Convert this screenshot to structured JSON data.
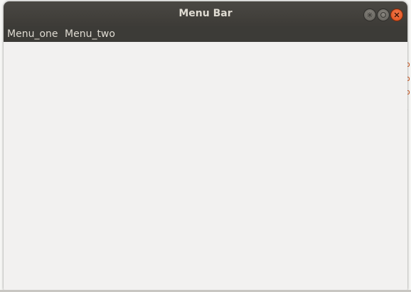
{
  "window": {
    "title": "Menu Bar",
    "controls": {
      "minimize_icon": "minimize-icon",
      "maximize_icon": "maximize-icon",
      "close_icon": "close-icon"
    }
  },
  "menubar": {
    "items": [
      {
        "label": "Menu_one"
      },
      {
        "label": "Menu_two"
      }
    ]
  },
  "background_glimpse": {
    "fragments": [
      "o",
      "o",
      "o",
      "i"
    ]
  },
  "colors": {
    "titlebar": "#3d3b37",
    "menubar": "#3c3b37",
    "menu_text": "#dfdbd2",
    "content": "#f2f1f0",
    "close_button": "#df4b16"
  }
}
